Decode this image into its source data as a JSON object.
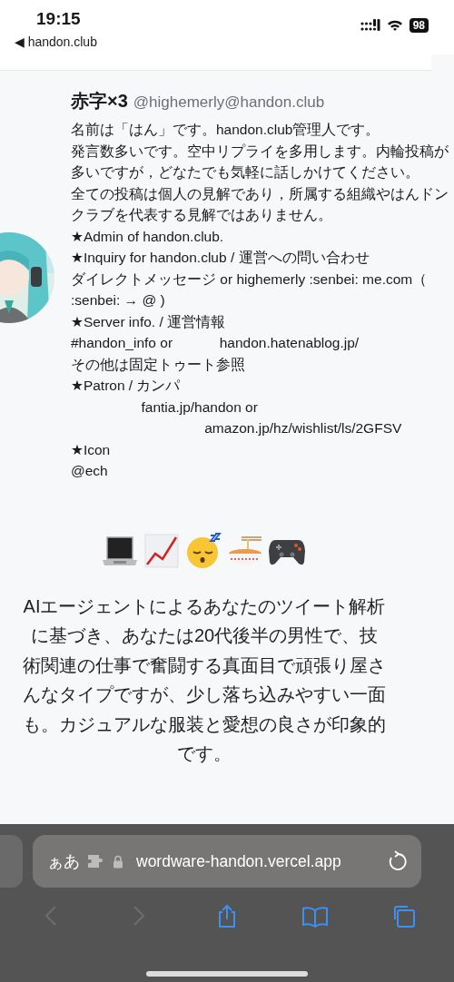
{
  "status_bar": {
    "time": "19:15",
    "back_link": "◀ handon.club",
    "battery": "98"
  },
  "profile": {
    "display_name": "赤字×3",
    "handle": "@highemerly@handon.club",
    "bio_lines": [
      "名前は「はん」です。handon.club管理人です。",
      "発言数多いです。空中リプライを多用します。内輪投稿が",
      "多いですが，どなたでも気軽に話しかけてください。",
      "全ての投稿は個人の見解であり，所属する組織やはんドン",
      "クラブを代表する見解ではありません。",
      "★Admin of handon.club.",
      "★Inquiry for handon.club / 運営への問い合わせ",
      "ダイレクトメッセージ or highemerly :senbei: me.com（",
      ":senbei: → @ )",
      "★Server info. / 運営情報",
      "#handon_info or            handon.hatenablog.jp/",
      "その他は固定トゥート参照",
      "★Patron / カンパ",
      "          fantia.jp/handon or",
      "                   amazon.jp/hz/wishlist/ls/2GFSV",
      "★Icon",
      "@ech"
    ]
  },
  "analysis": "AIエージェントによるあなたのツイート解析に基づき、あなたは20代後半の男性で、技術関連の仕事で奮闘する真面目で頑張り屋さんなタイプですが、少し落ち込みやすい一面も。カジュアルな服装と愛想の良さが印象的です。",
  "browser": {
    "reader_label": "ぁあ",
    "url": "wordware-handon.vercel.app",
    "toolbar": [
      {
        "kind": "back",
        "disabled": true
      },
      {
        "kind": "forward",
        "disabled": true
      },
      {
        "kind": "share",
        "disabled": false
      },
      {
        "kind": "bookmarks",
        "disabled": false
      },
      {
        "kind": "tabs",
        "disabled": false
      }
    ]
  }
}
